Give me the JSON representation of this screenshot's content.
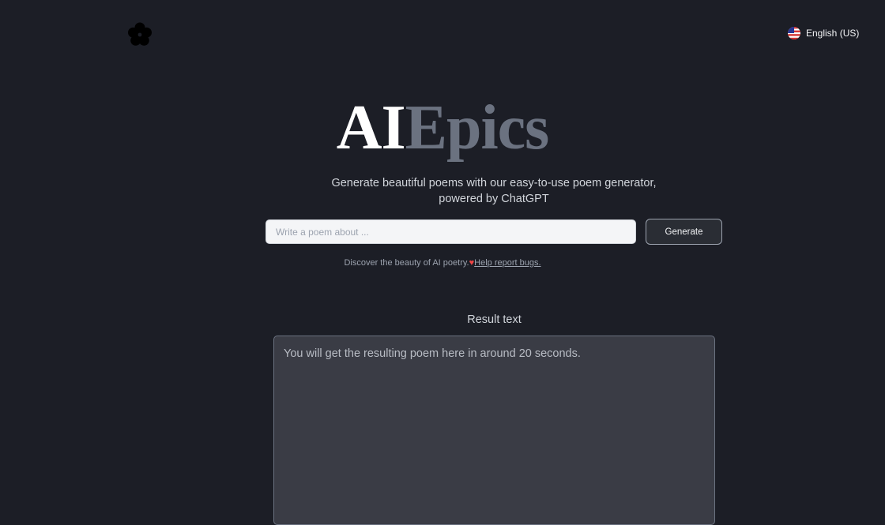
{
  "header": {
    "logo_icon": "flower-icon",
    "language": {
      "flag_icon": "us-flag-icon",
      "label": "English (US)"
    }
  },
  "hero": {
    "title_part1": "AI",
    "title_part2": "Epics",
    "subtitle": "Generate beautiful poems with our easy-to-use poem generator, powered by ChatGPT"
  },
  "form": {
    "input_value": "",
    "input_placeholder": "Write a poem about ...",
    "generate_label": "Generate"
  },
  "note": {
    "text": "Discover the beauty of AI poetry.",
    "heart_icon": "heart-icon",
    "link_text": "Help report bugs."
  },
  "result": {
    "heading": "Result text",
    "value": "",
    "placeholder": "You will get the resulting poem here in around 20 seconds."
  },
  "colors": {
    "background": "#1c1e26",
    "title_accent": "#6b7280",
    "heart": "#ef4444"
  }
}
